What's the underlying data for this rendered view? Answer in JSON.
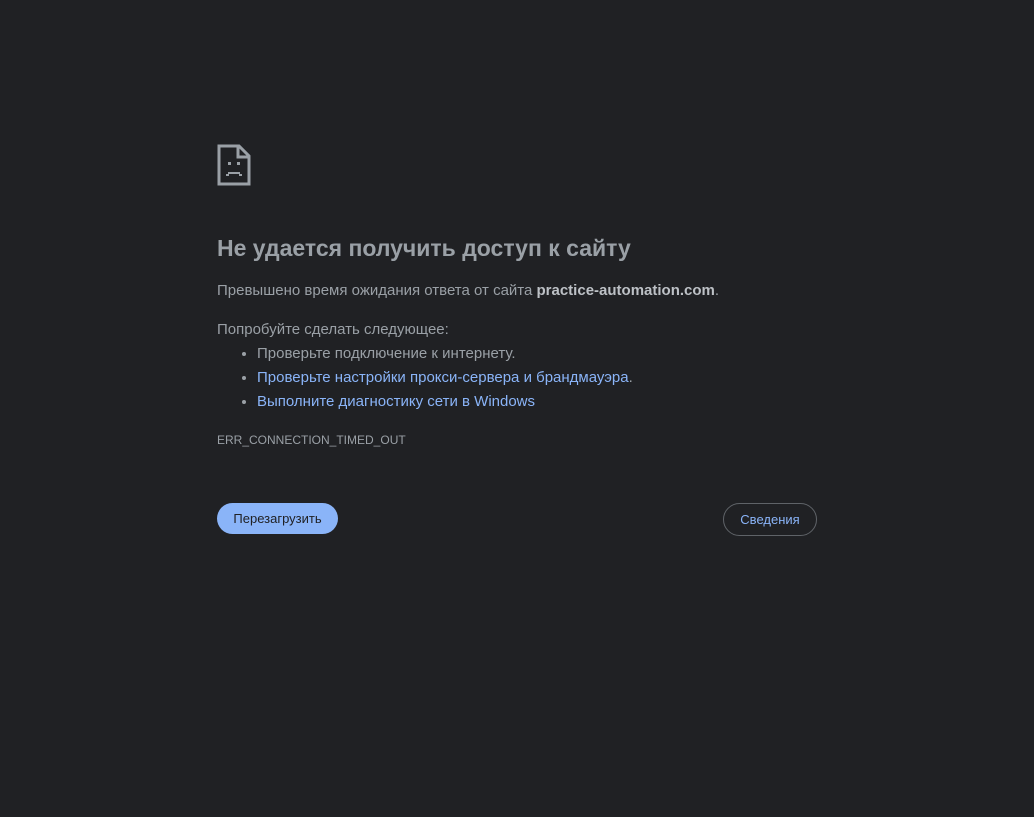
{
  "icon": "sad-document-icon",
  "error": {
    "title": "Не удается получить доступ к сайту",
    "summary_prefix": "Превышено время ожидания ответа от сайта ",
    "host": "practice-automation.com",
    "summary_suffix": ".",
    "suggestions_heading": "Попробуйте сделать следующее:",
    "suggestions": [
      {
        "text": "Проверьте подключение к интернету.",
        "suffix": ""
      },
      {
        "text": "Проверьте настройки прокси-сервера и брандмауэра",
        "suffix": "."
      },
      {
        "text": "Выполните диагностику сети в Windows",
        "suffix": ""
      }
    ],
    "code": "ERR_CONNECTION_TIMED_OUT"
  },
  "buttons": {
    "reload_label": "Перезагрузить",
    "details_label": "Сведения"
  },
  "colors": {
    "background": "#202124",
    "text": "#9aa0a6",
    "link": "#8ab4f8"
  }
}
